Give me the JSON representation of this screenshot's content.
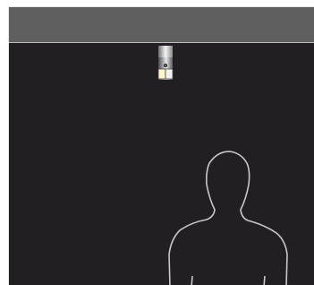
{
  "window": {
    "header_color": "#5f5f5f",
    "canvas_color": "#211f22",
    "outline_color": "#c8c8c8"
  },
  "icons": {
    "device": "camera-device-icon",
    "figure": "person-silhouette-icon"
  }
}
